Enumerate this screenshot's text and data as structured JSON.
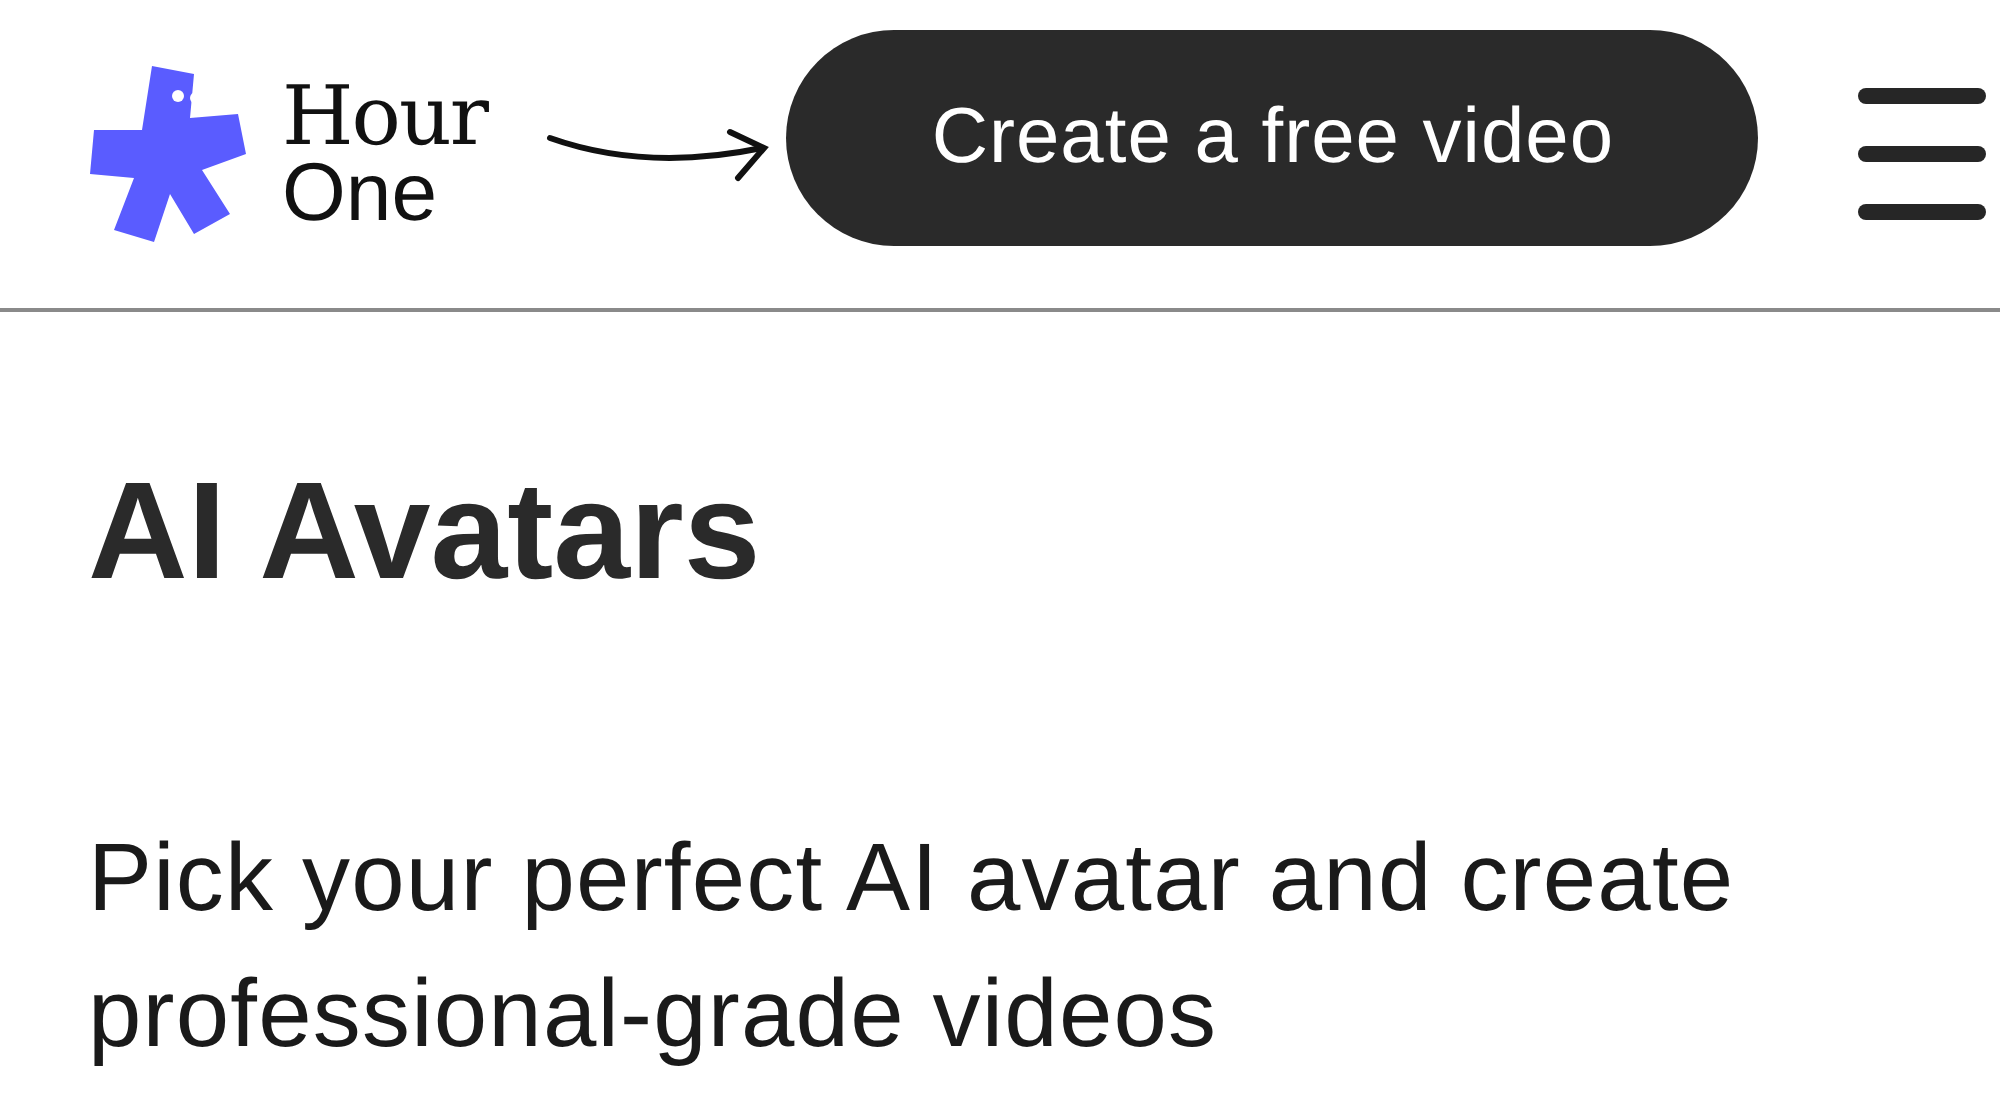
{
  "header": {
    "logo": {
      "line_1": "Hour",
      "line_2": "One"
    },
    "cta_button": "Create a free video"
  },
  "hero": {
    "title": "AI Avatars",
    "description": "Pick your perfect AI avatar and create professional-grade videos"
  }
}
